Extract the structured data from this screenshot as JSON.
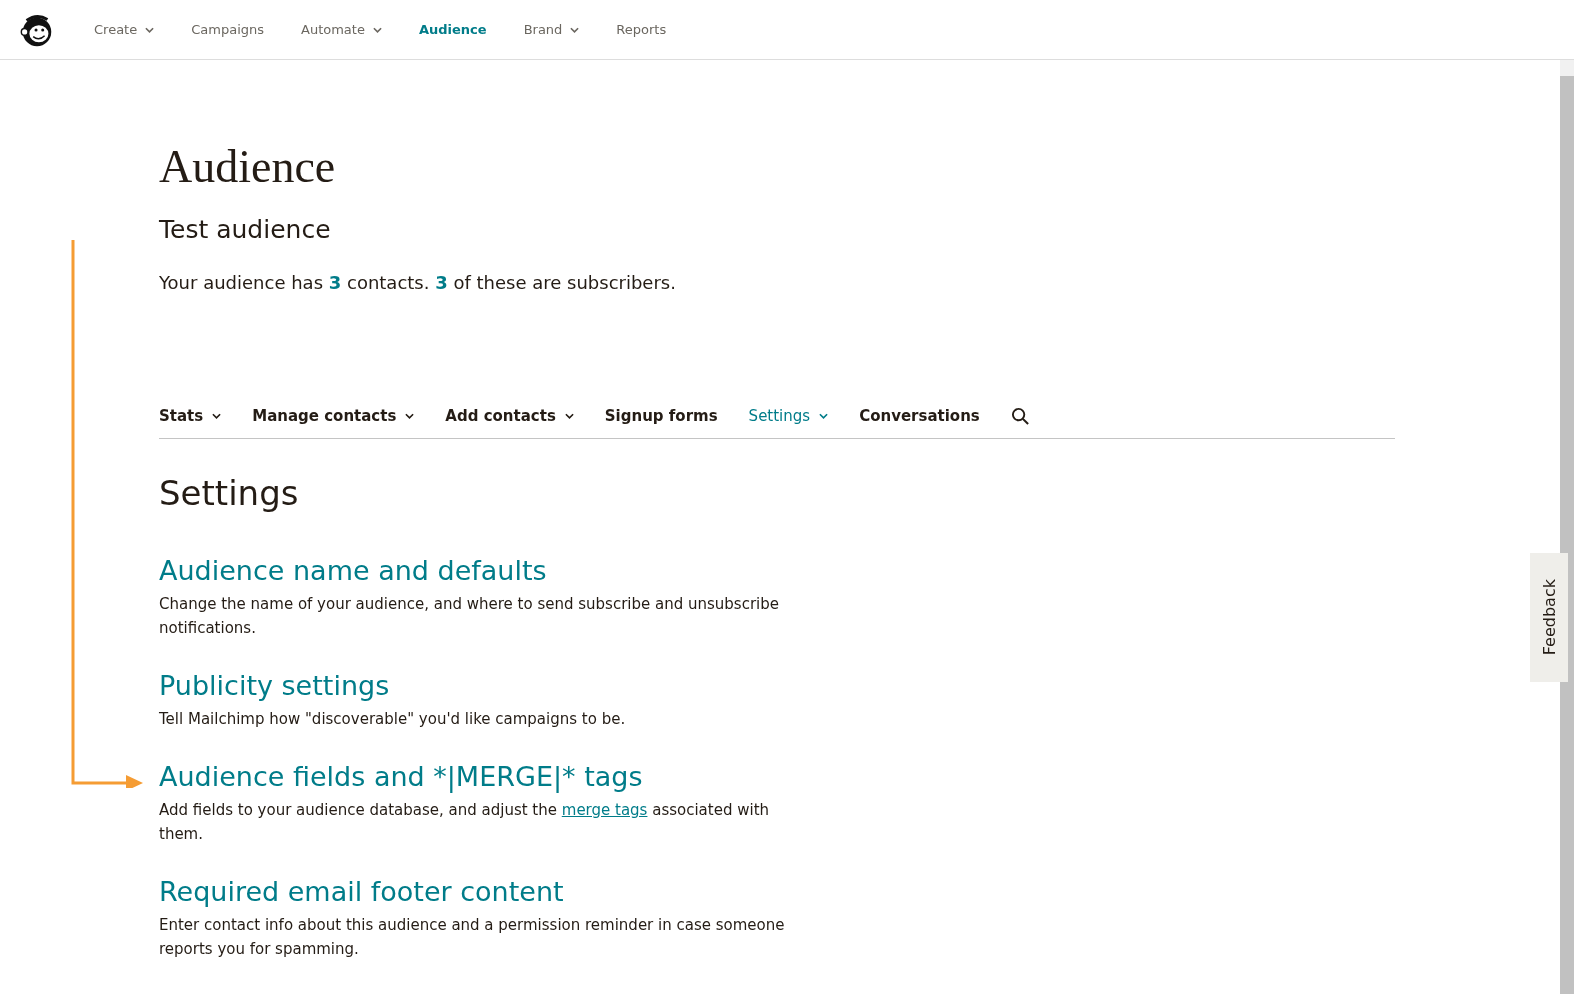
{
  "nav": {
    "items": [
      {
        "label": "Create",
        "dropdown": true,
        "selected": false
      },
      {
        "label": "Campaigns",
        "dropdown": false,
        "selected": false
      },
      {
        "label": "Automate",
        "dropdown": true,
        "selected": false
      },
      {
        "label": "Audience",
        "dropdown": false,
        "selected": true
      },
      {
        "label": "Brand",
        "dropdown": true,
        "selected": false
      },
      {
        "label": "Reports",
        "dropdown": false,
        "selected": false
      }
    ]
  },
  "page": {
    "title": "Audience",
    "audience_name": "Test audience",
    "summary": "Your audience has **3** contacts. **3** of these are subscribers."
  },
  "subnav": {
    "items": [
      {
        "label": "Stats",
        "dropdown": true,
        "selected": false
      },
      {
        "label": "Manage contacts",
        "dropdown": true,
        "selected": false
      },
      {
        "label": "Add contacts",
        "dropdown": true,
        "selected": false
      },
      {
        "label": "Signup forms",
        "dropdown": false,
        "selected": false
      },
      {
        "label": "Settings",
        "dropdown": true,
        "selected": true
      },
      {
        "label": "Conversations",
        "dropdown": false,
        "selected": false
      }
    ]
  },
  "settings": {
    "heading": "Settings",
    "sections": [
      {
        "title": "Audience name and defaults",
        "description": "Change the name of your audience, and where to send subscribe and unsubscribe notifications.",
        "annotated": false
      },
      {
        "title": "Publicity settings",
        "description": "Tell Mailchimp how \"discoverable\" you'd like campaigns to be.",
        "annotated": false
      },
      {
        "title": "Audience fields and *|MERGE|* tags",
        "description": "Add fields to your audience database, and adjust the",
        "link": "merge tags",
        "description_after": "associated with them.",
        "annotated": true
      },
      {
        "title": "Required email footer content",
        "description": "Enter contact info about this audience and a permission reminder in case someone reports you for spamming.",
        "annotated": false
      }
    ]
  },
  "feedback": {
    "label": "Feedback"
  }
}
